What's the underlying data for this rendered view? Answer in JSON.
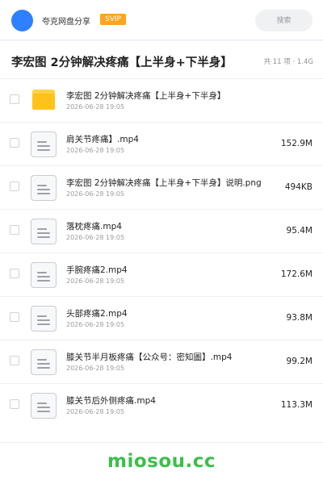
{
  "header": {
    "app_name": "夸克网盘分享",
    "badge": "SVIP",
    "search_placeholder": "搜索"
  },
  "folder": {
    "title": "李宏图 2分钟解决疼痛【上半身+下半身】",
    "meta": "共 11 项 · 1.4G"
  },
  "files": [
    {
      "name": "李宏图 2分钟解决疼痛【上半身+下半身】",
      "date": "2026-06-28 19:05",
      "size": "",
      "type": "folder-icon"
    },
    {
      "name": "肩关节疼痛】.mp4",
      "date": "2026-06-28 19:05",
      "size": "152.9M",
      "type": "file-icon"
    },
    {
      "name": "李宏图 2分钟解决疼痛【上半身+下半身】说明.png",
      "date": "2026-06-28 19:05",
      "size": "494KB",
      "type": "file-icon"
    },
    {
      "name": "落枕疼痛.mp4",
      "date": "2026-06-28 19:05",
      "size": "95.4M",
      "type": "file-icon"
    },
    {
      "name": "手腕疼痛2.mp4",
      "date": "2026-06-28 19:05",
      "size": "172.6M",
      "type": "file-icon"
    },
    {
      "name": "头部疼痛2.mp4",
      "date": "2026-06-28 19:05",
      "size": "93.8M",
      "type": "file-icon"
    },
    {
      "name": "膝关节半月板疼痛【公众号：密知圖】.mp4",
      "date": "2026-06-28 19:05",
      "size": "99.2M",
      "type": "file-icon"
    },
    {
      "name": "膝关节后外侧疼痛.mp4",
      "date": "2026-06-28 19:05",
      "size": "113.3M",
      "type": "file-icon"
    }
  ],
  "footer": {
    "watermark": "miosou.cc"
  },
  "colors": {
    "accent": "#2f80ff",
    "badge": "#ffa321",
    "watermark": "#3cbf4a",
    "folder": "#ffc21a"
  }
}
